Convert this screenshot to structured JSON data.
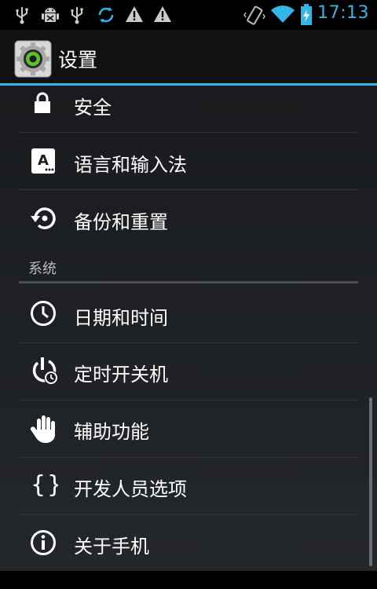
{
  "status_bar": {
    "time": "17:13",
    "icons": [
      "usb-icon",
      "android-debug-icon",
      "usb-icon",
      "sync-icon",
      "warning-icon",
      "warning-icon",
      "vibrate-icon",
      "wifi-icon",
      "battery-charging-icon"
    ],
    "accent": "#33b5e5"
  },
  "action_bar": {
    "title": "设置",
    "icon": "settings-gear-icon"
  },
  "settings": {
    "items_top": [
      {
        "label": "安全",
        "icon": "lock-icon"
      },
      {
        "label": "语言和输入法",
        "icon": "keyboard-a-icon"
      },
      {
        "label": "备份和重置",
        "icon": "backup-restore-icon"
      }
    ],
    "section_header": "系统",
    "items_system": [
      {
        "label": "日期和时间",
        "icon": "clock-icon"
      },
      {
        "label": "定时开关机",
        "icon": "scheduled-power-icon"
      },
      {
        "label": "辅助功能",
        "icon": "hand-icon"
      },
      {
        "label": "开发人员选项",
        "icon": "braces-icon"
      },
      {
        "label": "关于手机",
        "icon": "info-icon"
      }
    ]
  }
}
